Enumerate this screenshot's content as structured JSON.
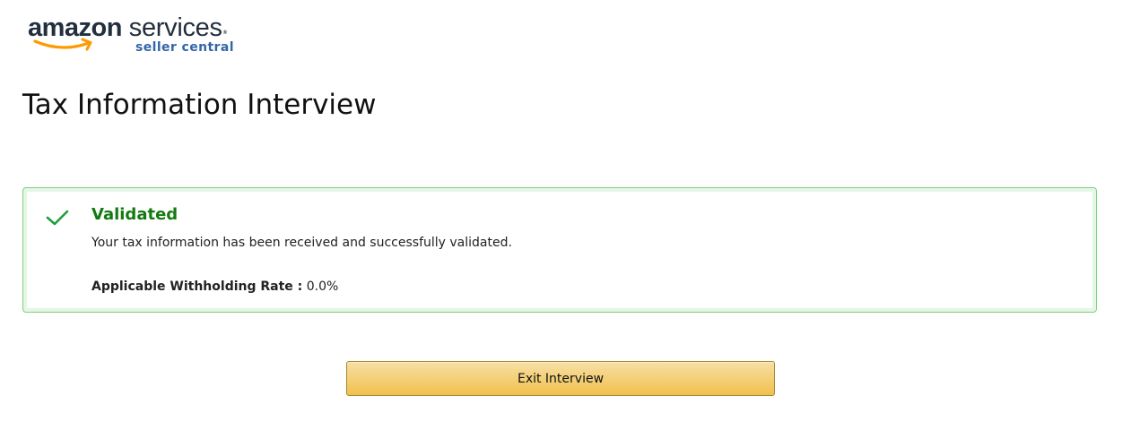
{
  "brand": {
    "name_bold": "amazon",
    "name_regular": " services",
    "trademark": "®",
    "subtitle": "seller central",
    "smile_color": "#ff9900",
    "subtitle_color": "#3366a8"
  },
  "page": {
    "title": "Tax Information Interview"
  },
  "alert": {
    "status": "success",
    "icon": "checkmark-icon",
    "heading": "Validated",
    "message": "Your tax information has been received and successfully validated.",
    "rate_label": "Applicable Withholding Rate :",
    "rate_value": "0.0%",
    "colors": {
      "border": "#7fcf7f",
      "inner_glow": "#e4f6e4",
      "heading": "#117a11",
      "check": "#1f9e3a"
    }
  },
  "actions": {
    "exit_label": "Exit Interview",
    "button_color": "#f0c14b"
  }
}
